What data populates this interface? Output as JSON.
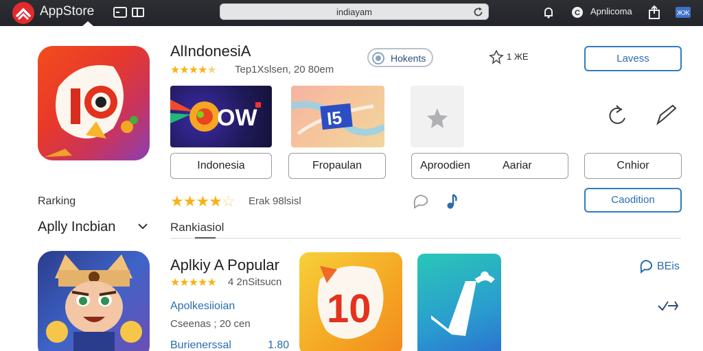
{
  "topbar": {
    "brand": "AppStore",
    "url": "indiayam",
    "account": "Apnlicoma",
    "icons": [
      "appstore-logo-icon",
      "window-icon",
      "sidebar-icon",
      "reload-icon",
      "notification-icon",
      "account-icon",
      "share-icon",
      "flag-icon"
    ]
  },
  "app1": {
    "title": "AlIndonesiA",
    "rating_stars": 4.5,
    "meta": "Tep1Xslsen, 20 80em",
    "badge": "Hokents",
    "count": "1 ЖE",
    "action": "Lavess",
    "thumb2_text": "OW",
    "thumb3_text": "I5"
  },
  "chips": [
    "Indonesia",
    "Fropaulan"
  ],
  "wide_chip": {
    "left": "Aproodien",
    "right": "Aariar"
  },
  "side_chip": "Cnhior",
  "rating_row": {
    "stars": 4.5,
    "text": "Erak 98lsisl"
  },
  "caption_button": "Caodition",
  "ranking": {
    "label": "Rarking",
    "selector": "Aplly Incbian",
    "tab": "Rankiasiol"
  },
  "app2": {
    "title": "Aplkiy A Popular",
    "rating_stars": 4.5,
    "meta": "4 2nSitsucn",
    "category": "Apolkesiioian",
    "details": "Cseenas ; 20 cen",
    "publisher": "Burienerssal",
    "size": "1.80",
    "side_link": "BEis",
    "thumb1_text": "10"
  },
  "colors": {
    "topbar": "#2a2b30",
    "accent_blue": "#2f7bc4",
    "star": "#f5b416",
    "logo_red": "#e32a2e"
  }
}
